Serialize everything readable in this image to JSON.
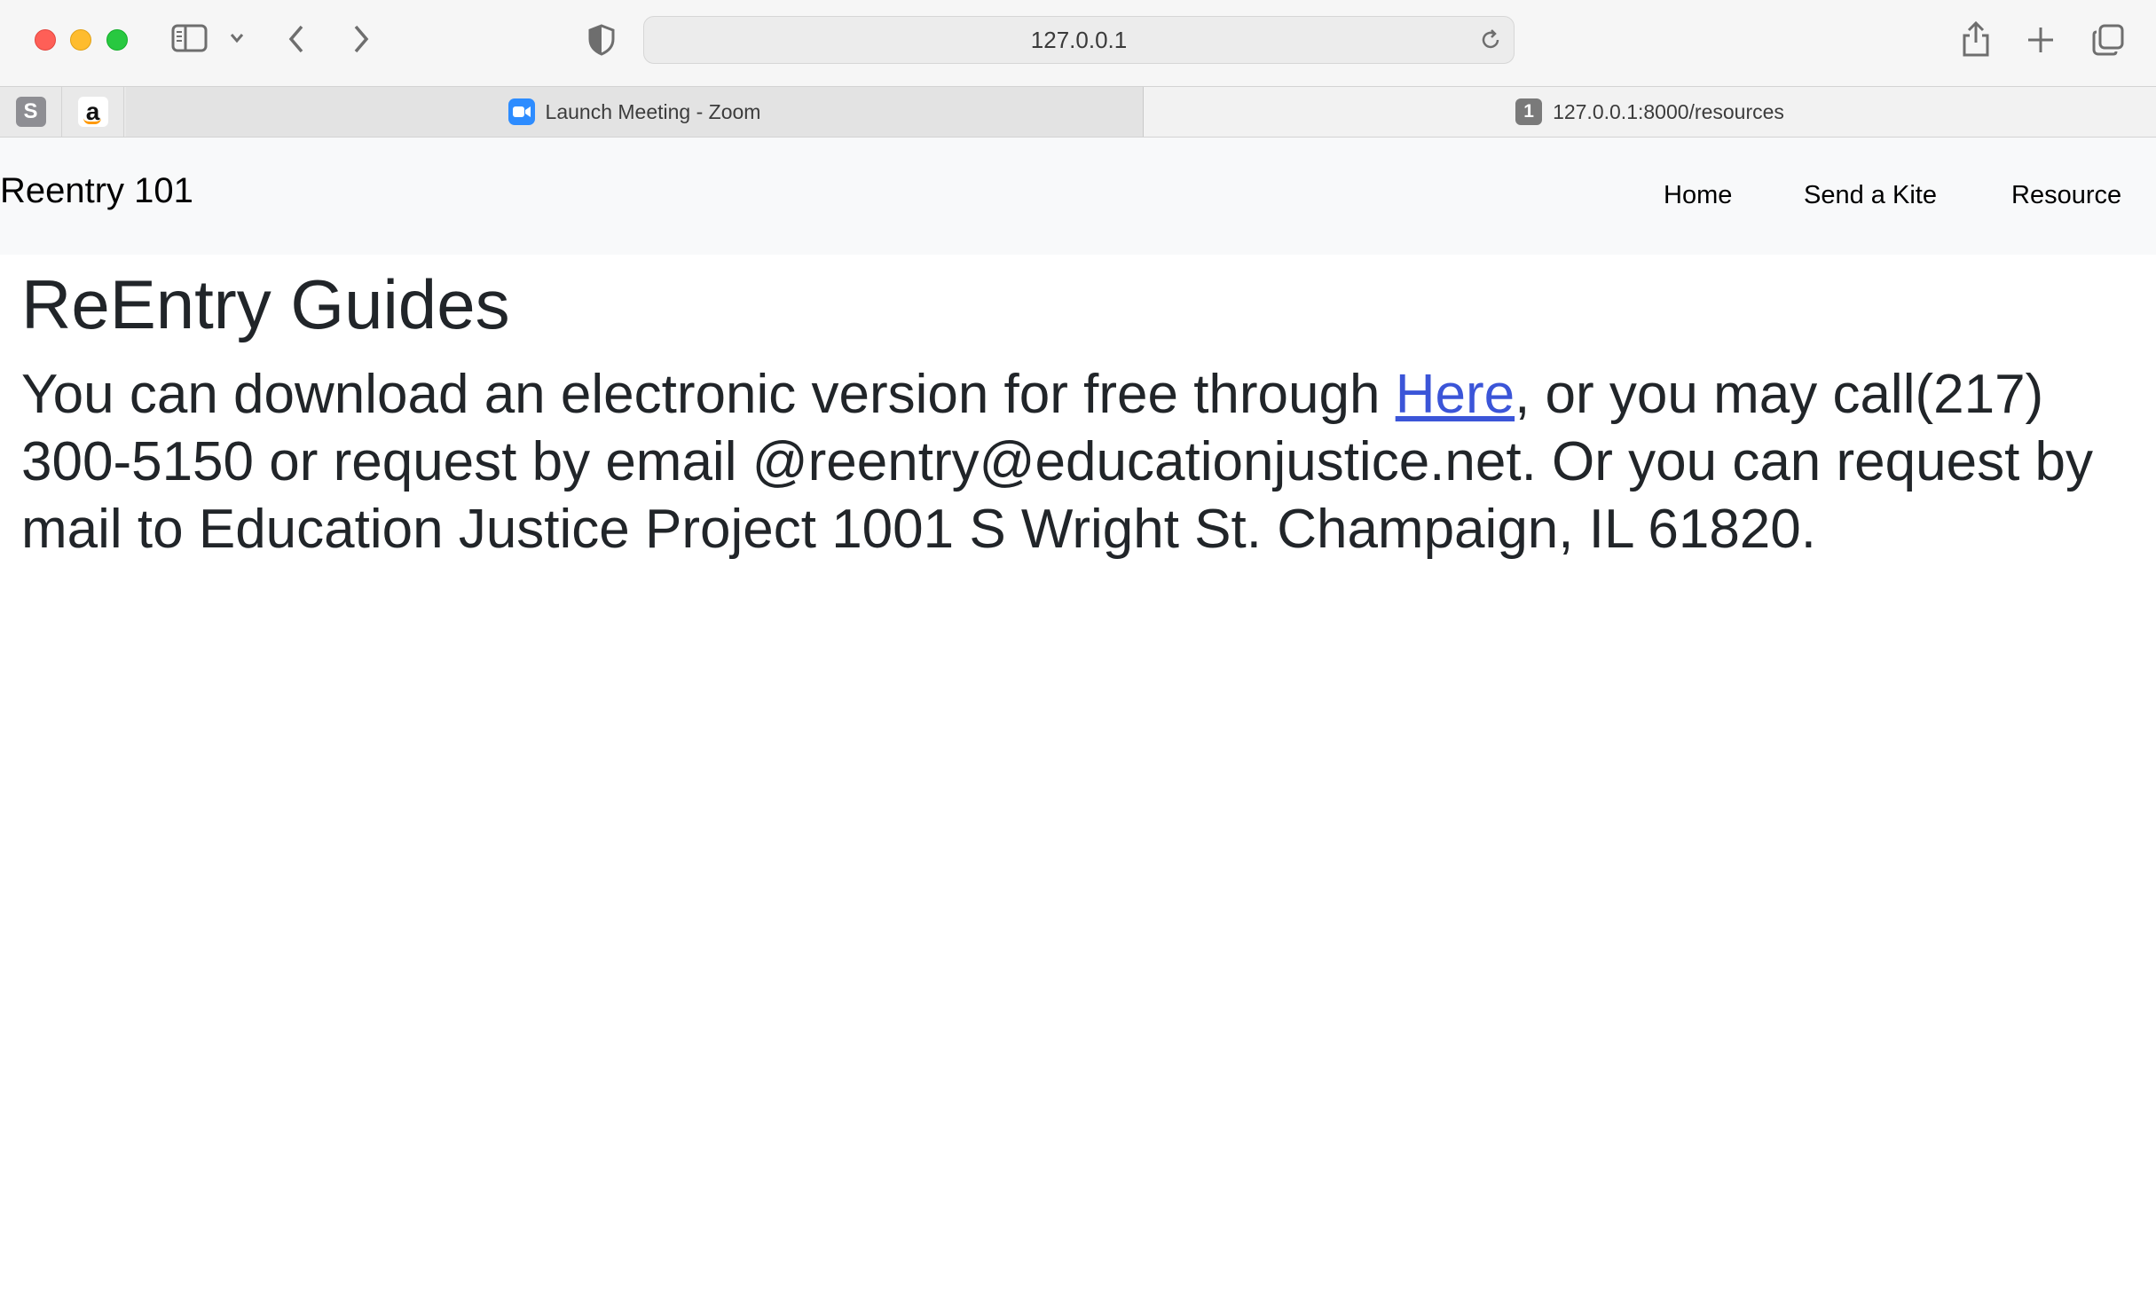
{
  "browser": {
    "address": "127.0.0.1",
    "pinned_tabs": [
      {
        "letter": "S",
        "icon": "s-favicon-icon"
      },
      {
        "letter": "a",
        "icon": "amazon-icon"
      }
    ],
    "tabs": [
      {
        "label": "Launch Meeting - Zoom",
        "icon": "zoom-icon",
        "active": false
      },
      {
        "label": "127.0.0.1:8000/resources",
        "badge": "1",
        "active": true
      }
    ]
  },
  "navbar": {
    "brand": "Reentry 101",
    "links": [
      "Home",
      "Send a Kite",
      "Resource"
    ]
  },
  "main": {
    "heading": "ReEntry Guides",
    "text_before_link": "You can download an electronic version for free through ",
    "link_text": "Here",
    "text_after_link": ", or you may call(217) 300-5150 or request by email @reentry@educationjustice.net. Or you can request by mail to Education Justice Project 1001 S Wright St. Champaign, IL 61820."
  },
  "colors": {
    "link": "#3b55d8",
    "navbar_bg": "#f8f9fa",
    "text": "#212529"
  }
}
